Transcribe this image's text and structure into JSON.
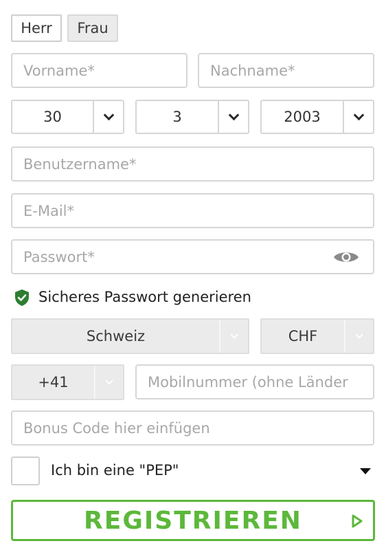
{
  "gender": {
    "herr": "Herr",
    "frau": "Frau"
  },
  "fields": {
    "vorname": "Vorname*",
    "nachname": "Nachname*",
    "benutzername": "Benutzername*",
    "email": "E-Mail*",
    "passwort": "Passwort*",
    "mobil": "Mobilnummer (ohne Länder",
    "bonus": "Bonus Code hier einfügen"
  },
  "dob": {
    "day": "30",
    "month": "3",
    "year": "2003"
  },
  "generate_password": "Sicheres Passwort generieren",
  "country": "Schweiz",
  "currency": "CHF",
  "phone_prefix": "+41",
  "pep_label": "Ich bin eine \"PEP\"",
  "register_label": "REGISTRIEREN",
  "colors": {
    "accent": "#5cb83a",
    "shield": "#2e7d32"
  }
}
